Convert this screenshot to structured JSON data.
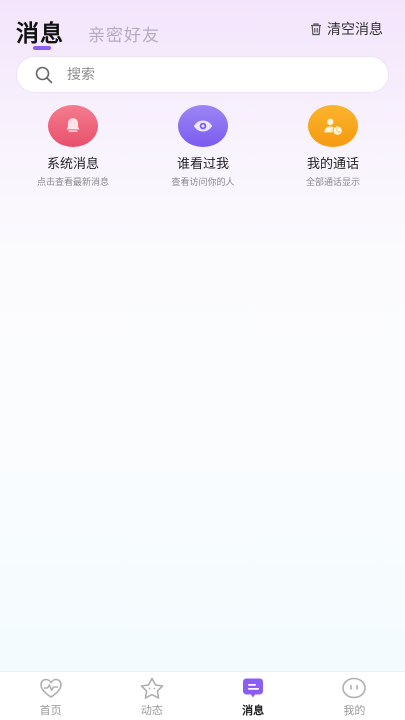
{
  "header": {
    "tab_messages": "消息",
    "tab_friends": "亲密好友",
    "clear_label": "清空消息"
  },
  "search": {
    "placeholder": "搜索"
  },
  "shortcuts": [
    {
      "title": "系统消息",
      "subtitle": "点击查看最新消息",
      "icon": "bell-icon",
      "color": "#ee6179"
    },
    {
      "title": "谁看过我",
      "subtitle": "查看访问你的人",
      "icon": "eye-icon",
      "color": "#8a6df2"
    },
    {
      "title": "我的通话",
      "subtitle": "全部通话显示",
      "icon": "contact-call-icon",
      "color": "#f8a71c"
    }
  ],
  "bottom_nav": {
    "items": [
      {
        "label": "首页",
        "icon": "heartbeat-icon",
        "active": false
      },
      {
        "label": "动态",
        "icon": "star-icon",
        "active": false
      },
      {
        "label": "消息",
        "icon": "message-icon",
        "active": true
      },
      {
        "label": "我的",
        "icon": "face-icon",
        "active": false
      }
    ]
  },
  "colors": {
    "accent": "#8b5cf6"
  }
}
